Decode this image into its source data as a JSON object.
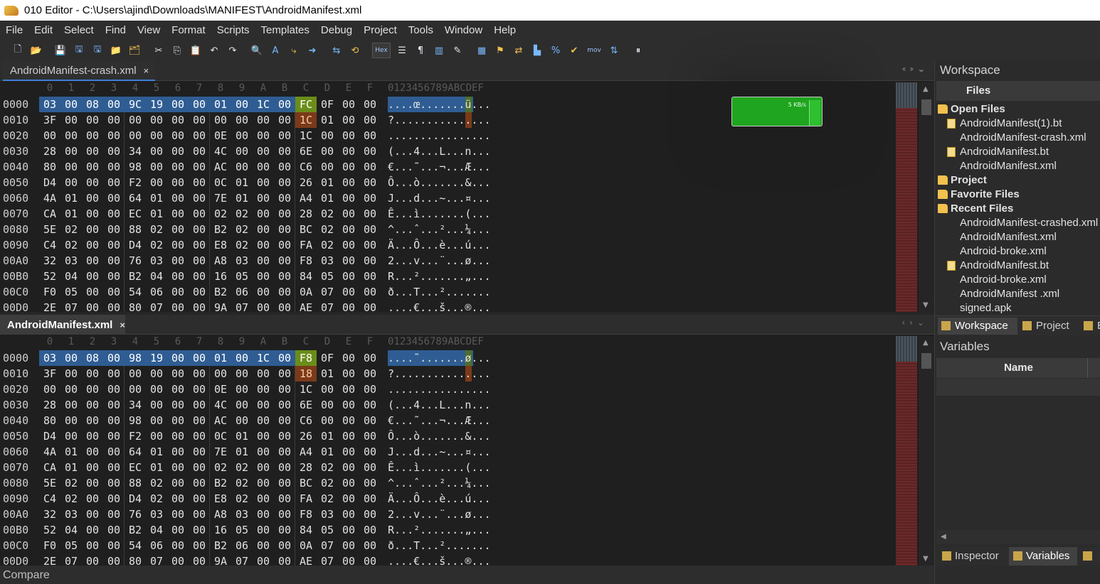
{
  "window": {
    "title": "010 Editor - C:\\Users\\ajind\\Downloads\\MANIFEST\\AndroidManifest.xml"
  },
  "menu": [
    "File",
    "Edit",
    "Select",
    "Find",
    "View",
    "Format",
    "Scripts",
    "Templates",
    "Debug",
    "Project",
    "Tools",
    "Window",
    "Help"
  ],
  "toolbar": {
    "hex_label": "Hex",
    "mov_label": "mov"
  },
  "hex_header": {
    "columns": [
      "0",
      "1",
      "2",
      "3",
      "4",
      "5",
      "6",
      "7",
      "8",
      "9",
      "A",
      "B",
      "C",
      "D",
      "E",
      "F"
    ],
    "ascii": "0123456789ABCDEF"
  },
  "panes": [
    {
      "tab": "AndroidManifest-crash.xml",
      "close": "×",
      "rows": [
        {
          "off": "0000",
          "bytes": [
            "03",
            "00",
            "08",
            "00",
            "9C",
            "19",
            "00",
            "00",
            "01",
            "00",
            "1C",
            "00",
            "FC",
            "0F",
            "00",
            "00"
          ],
          "ascii": "....œ.......ü..."
        },
        {
          "off": "0010",
          "bytes": [
            "3F",
            "00",
            "00",
            "00",
            "00",
            "00",
            "00",
            "00",
            "00",
            "00",
            "00",
            "00",
            "1C",
            "01",
            "00",
            "00"
          ],
          "ascii": "?..............."
        },
        {
          "off": "0020",
          "bytes": [
            "00",
            "00",
            "00",
            "00",
            "00",
            "00",
            "00",
            "00",
            "0E",
            "00",
            "00",
            "00",
            "1C",
            "00",
            "00",
            "00"
          ],
          "ascii": "................"
        },
        {
          "off": "0030",
          "bytes": [
            "28",
            "00",
            "00",
            "00",
            "34",
            "00",
            "00",
            "00",
            "4C",
            "00",
            "00",
            "00",
            "6E",
            "00",
            "00",
            "00"
          ],
          "ascii": "(...4...L...n..."
        },
        {
          "off": "0040",
          "bytes": [
            "80",
            "00",
            "00",
            "00",
            "98",
            "00",
            "00",
            "00",
            "AC",
            "00",
            "00",
            "00",
            "C6",
            "00",
            "00",
            "00"
          ],
          "ascii": "€...˜...¬...Æ..."
        },
        {
          "off": "0050",
          "bytes": [
            "D4",
            "00",
            "00",
            "00",
            "F2",
            "00",
            "00",
            "00",
            "0C",
            "01",
            "00",
            "00",
            "26",
            "01",
            "00",
            "00"
          ],
          "ascii": "Ô...ò.......&..."
        },
        {
          "off": "0060",
          "bytes": [
            "4A",
            "01",
            "00",
            "00",
            "64",
            "01",
            "00",
            "00",
            "7E",
            "01",
            "00",
            "00",
            "A4",
            "01",
            "00",
            "00"
          ],
          "ascii": "J...d...~...¤..."
        },
        {
          "off": "0070",
          "bytes": [
            "CA",
            "01",
            "00",
            "00",
            "EC",
            "01",
            "00",
            "00",
            "02",
            "02",
            "00",
            "00",
            "28",
            "02",
            "00",
            "00"
          ],
          "ascii": "Ê...ì.......(..."
        },
        {
          "off": "0080",
          "bytes": [
            "5E",
            "02",
            "00",
            "00",
            "88",
            "02",
            "00",
            "00",
            "B2",
            "02",
            "00",
            "00",
            "BC",
            "02",
            "00",
            "00"
          ],
          "ascii": "^...ˆ...²...¼..."
        },
        {
          "off": "0090",
          "bytes": [
            "C4",
            "02",
            "00",
            "00",
            "D4",
            "02",
            "00",
            "00",
            "E8",
            "02",
            "00",
            "00",
            "FA",
            "02",
            "00",
            "00"
          ],
          "ascii": "Ä...Ô...è...ú..."
        },
        {
          "off": "00A0",
          "bytes": [
            "32",
            "03",
            "00",
            "00",
            "76",
            "03",
            "00",
            "00",
            "A8",
            "03",
            "00",
            "00",
            "F8",
            "03",
            "00",
            "00"
          ],
          "ascii": "2...v...¨...ø..."
        },
        {
          "off": "00B0",
          "bytes": [
            "52",
            "04",
            "00",
            "00",
            "B2",
            "04",
            "00",
            "00",
            "16",
            "05",
            "00",
            "00",
            "84",
            "05",
            "00",
            "00"
          ],
          "ascii": "R...².......„..."
        },
        {
          "off": "00C0",
          "bytes": [
            "F0",
            "05",
            "00",
            "00",
            "54",
            "06",
            "00",
            "00",
            "B2",
            "06",
            "00",
            "00",
            "0A",
            "07",
            "00",
            "00"
          ],
          "ascii": "ð...T...²......."
        },
        {
          "off": "00D0",
          "bytes": [
            "2E",
            "07",
            "00",
            "00",
            "80",
            "07",
            "00",
            "00",
            "9A",
            "07",
            "00",
            "00",
            "AE",
            "07",
            "00",
            "00"
          ],
          "ascii": "....€...š...®..."
        }
      ]
    },
    {
      "tab": "AndroidManifest.xml",
      "close": "×",
      "rows": [
        {
          "off": "0000",
          "bytes": [
            "03",
            "00",
            "08",
            "00",
            "98",
            "19",
            "00",
            "00",
            "01",
            "00",
            "1C",
            "00",
            "F8",
            "0F",
            "00",
            "00"
          ],
          "ascii": "....˜.......ø..."
        },
        {
          "off": "0010",
          "bytes": [
            "3F",
            "00",
            "00",
            "00",
            "00",
            "00",
            "00",
            "00",
            "00",
            "00",
            "00",
            "00",
            "18",
            "01",
            "00",
            "00"
          ],
          "ascii": "?..............."
        },
        {
          "off": "0020",
          "bytes": [
            "00",
            "00",
            "00",
            "00",
            "00",
            "00",
            "00",
            "00",
            "0E",
            "00",
            "00",
            "00",
            "1C",
            "00",
            "00",
            "00"
          ],
          "ascii": "................"
        },
        {
          "off": "0030",
          "bytes": [
            "28",
            "00",
            "00",
            "00",
            "34",
            "00",
            "00",
            "00",
            "4C",
            "00",
            "00",
            "00",
            "6E",
            "00",
            "00",
            "00"
          ],
          "ascii": "(...4...L...n..."
        },
        {
          "off": "0040",
          "bytes": [
            "80",
            "00",
            "00",
            "00",
            "98",
            "00",
            "00",
            "00",
            "AC",
            "00",
            "00",
            "00",
            "C6",
            "00",
            "00",
            "00"
          ],
          "ascii": "€...˜...¬...Æ..."
        },
        {
          "off": "0050",
          "bytes": [
            "D4",
            "00",
            "00",
            "00",
            "F2",
            "00",
            "00",
            "00",
            "0C",
            "01",
            "00",
            "00",
            "26",
            "01",
            "00",
            "00"
          ],
          "ascii": "Ô...ò.......&..."
        },
        {
          "off": "0060",
          "bytes": [
            "4A",
            "01",
            "00",
            "00",
            "64",
            "01",
            "00",
            "00",
            "7E",
            "01",
            "00",
            "00",
            "A4",
            "01",
            "00",
            "00"
          ],
          "ascii": "J...d...~...¤..."
        },
        {
          "off": "0070",
          "bytes": [
            "CA",
            "01",
            "00",
            "00",
            "EC",
            "01",
            "00",
            "00",
            "02",
            "02",
            "00",
            "00",
            "28",
            "02",
            "00",
            "00"
          ],
          "ascii": "Ê...ì.......(..."
        },
        {
          "off": "0080",
          "bytes": [
            "5E",
            "02",
            "00",
            "00",
            "88",
            "02",
            "00",
            "00",
            "B2",
            "02",
            "00",
            "00",
            "BC",
            "02",
            "00",
            "00"
          ],
          "ascii": "^...ˆ...²...¼..."
        },
        {
          "off": "0090",
          "bytes": [
            "C4",
            "02",
            "00",
            "00",
            "D4",
            "02",
            "00",
            "00",
            "E8",
            "02",
            "00",
            "00",
            "FA",
            "02",
            "00",
            "00"
          ],
          "ascii": "Ä...Ô...è...ú..."
        },
        {
          "off": "00A0",
          "bytes": [
            "32",
            "03",
            "00",
            "00",
            "76",
            "03",
            "00",
            "00",
            "A8",
            "03",
            "00",
            "00",
            "F8",
            "03",
            "00",
            "00"
          ],
          "ascii": "2...v...¨...ø..."
        },
        {
          "off": "00B0",
          "bytes": [
            "52",
            "04",
            "00",
            "00",
            "B2",
            "04",
            "00",
            "00",
            "16",
            "05",
            "00",
            "00",
            "84",
            "05",
            "00",
            "00"
          ],
          "ascii": "R...².......„..."
        },
        {
          "off": "00C0",
          "bytes": [
            "F0",
            "05",
            "00",
            "00",
            "54",
            "06",
            "00",
            "00",
            "B2",
            "06",
            "00",
            "00",
            "0A",
            "07",
            "00",
            "00"
          ],
          "ascii": "ð...T...²......."
        },
        {
          "off": "00D0",
          "bytes": [
            "2E",
            "07",
            "00",
            "00",
            "80",
            "07",
            "00",
            "00",
            "9A",
            "07",
            "00",
            "00",
            "AE",
            "07",
            "00",
            "00"
          ],
          "ascii": "....€...š...®..."
        }
      ]
    }
  ],
  "status": {
    "compare": "Compare"
  },
  "widget": {
    "text": "5 KB/s"
  },
  "workspace": {
    "title": "Workspace",
    "files_header": "Files",
    "groups": [
      {
        "label": "Open Files",
        "items": [
          {
            "label": "AndroidManifest(1).bt",
            "bt": true
          },
          {
            "label": "AndroidManifest-crash.xml",
            "bt": false
          },
          {
            "label": "AndroidManifest.bt",
            "bt": true
          },
          {
            "label": "AndroidManifest.xml",
            "bt": false
          }
        ]
      },
      {
        "label": "Project",
        "items": []
      },
      {
        "label": "Favorite Files",
        "items": []
      },
      {
        "label": "Recent Files",
        "items": [
          {
            "label": "AndroidManifest-crashed.xml",
            "bt": false
          },
          {
            "label": "AndroidManifest.xml",
            "bt": false
          },
          {
            "label": "Android-broke.xml",
            "bt": false
          },
          {
            "label": "AndroidManifest.bt",
            "bt": true
          },
          {
            "label": "Android-broke.xml",
            "bt": false
          },
          {
            "label": "AndroidManifest .xml",
            "bt": false
          },
          {
            "label": "signed.apk",
            "bt": false
          }
        ]
      }
    ],
    "tabs": [
      "Workspace",
      "Project",
      "B"
    ]
  },
  "variables": {
    "title": "Variables",
    "name_col": "Name"
  },
  "bottom_tabs": [
    "Inspector",
    "Variables"
  ],
  "colors": {
    "selection": "#2f5d93",
    "diff_green": "#6b8d1a",
    "diff_orange": "#7b3a1a",
    "background": "#1f1f1f"
  }
}
